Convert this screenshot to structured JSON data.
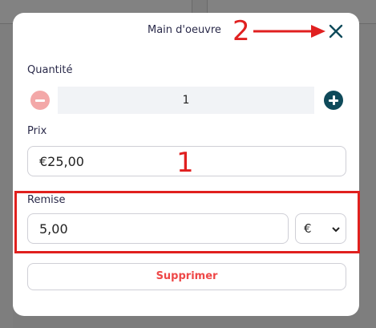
{
  "modal": {
    "title": "Main d'oeuvre",
    "close_icon": "close-icon"
  },
  "annotations": {
    "one": "1",
    "two": "2",
    "color": "#e02020"
  },
  "quantity": {
    "label": "Quantité",
    "value": "1",
    "minus_icon": "minus-circle-icon",
    "plus_icon": "plus-circle-icon",
    "minus_color": "#f3a8a8",
    "plus_color": "#0f4a5a"
  },
  "price": {
    "label": "Prix",
    "value": "€25,00"
  },
  "discount": {
    "label": "Remise",
    "value": "5,00",
    "unit_selected": "€"
  },
  "actions": {
    "delete_label": "Supprimer",
    "delete_color": "#ee4848"
  }
}
